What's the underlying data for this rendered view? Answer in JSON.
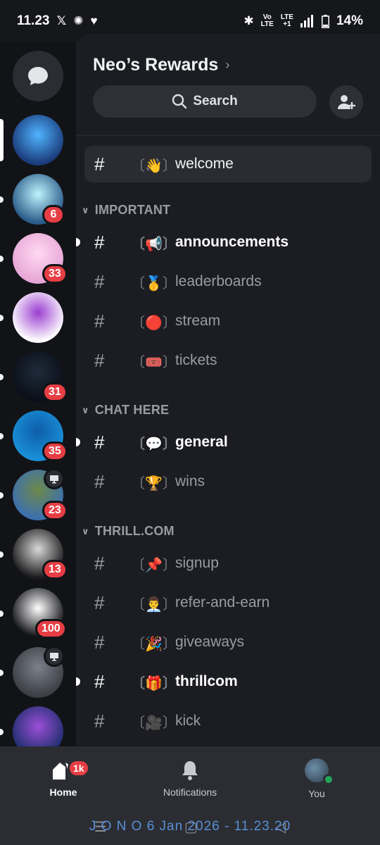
{
  "status_bar": {
    "time": "11.23",
    "left_icons": [
      "x-icon",
      "aperture-icon",
      "heart-icon"
    ],
    "network_top": "Vo",
    "network_bottom": "LTE",
    "lte_top": "LTE",
    "lte_bottom": "+1",
    "battery": "14%"
  },
  "servers": [
    {
      "name": "server-1",
      "badge": "",
      "colors": [
        "#1a3b7a",
        "#4fb4ff"
      ]
    },
    {
      "name": "server-2",
      "badge": "6",
      "colors": [
        "#2a5a88",
        "#bff4ff"
      ]
    },
    {
      "name": "server-3",
      "badge": "33",
      "colors": [
        "#e7a6d6",
        "#ffd9f2"
      ]
    },
    {
      "name": "server-4",
      "badge": "",
      "colors": [
        "#ffffff",
        "#9b3fd1"
      ]
    },
    {
      "name": "server-5",
      "badge": "31",
      "colors": [
        "#0b0f18",
        "#1e2b3a"
      ]
    },
    {
      "name": "server-6",
      "badge": "35",
      "colors": [
        "#1a8fd8",
        "#0d5ea8"
      ]
    },
    {
      "name": "server-7",
      "badge": "23",
      "colors": [
        "#3b6fae",
        "#6e8a4a"
      ]
    },
    {
      "name": "server-8",
      "badge": "13",
      "colors": [
        "#1b1b1d",
        "#d9d9d9"
      ]
    },
    {
      "name": "server-9",
      "badge": "100",
      "colors": [
        "#121317",
        "#ffffff"
      ]
    },
    {
      "name": "server-10",
      "badge": "",
      "colors": [
        "#3c3f45",
        "#7b808a"
      ]
    },
    {
      "name": "server-11",
      "badge": "",
      "colors": [
        "#1f2e6e",
        "#9b4fd8"
      ]
    }
  ],
  "server": {
    "name": "Neo’s Rewards",
    "chevron": "›",
    "search_label": "Search"
  },
  "channels_top": [
    {
      "hash": "#",
      "emoji": "〔👋〕",
      "name": "welcome"
    }
  ],
  "categories": [
    {
      "label": "IMPORTANT",
      "channels": [
        {
          "hash": "#",
          "emoji": "〔📢〕",
          "name": "announcements",
          "unread": true
        },
        {
          "hash": "#",
          "emoji": "〔🥇〕",
          "name": "leaderboards",
          "unread": false
        },
        {
          "hash": "#",
          "emoji": "〔🔴〕",
          "name": "stream",
          "unread": false
        },
        {
          "hash": "#",
          "emoji": "〔🎟️〕",
          "name": "tickets",
          "unread": false
        }
      ]
    },
    {
      "label": "CHAT HERE",
      "channels": [
        {
          "hash": "#",
          "emoji": "〔💬〕",
          "name": "general",
          "unread": true
        },
        {
          "hash": "#",
          "emoji": "〔🏆〕",
          "name": "wins",
          "unread": false
        }
      ]
    },
    {
      "label": "THRILL.COM",
      "channels": [
        {
          "hash": "#",
          "emoji": "〔📌〕",
          "name": "signup",
          "unread": false
        },
        {
          "hash": "#",
          "emoji": "〔👨‍💼〕",
          "name": "refer-and-earn",
          "unread": false
        },
        {
          "hash": "#",
          "emoji": "〔🎉〕",
          "name": "giveaways",
          "unread": false
        },
        {
          "hash": "#",
          "emoji": "〔🎁〕",
          "name": "thrillcom",
          "unread": true
        },
        {
          "hash": "#",
          "emoji": "〔🎥〕",
          "name": "kick",
          "unread": false
        }
      ]
    }
  ],
  "bottom_nav": {
    "home_label": "Home",
    "home_badge": "1k",
    "notifications_label": "Notifications",
    "you_label": "You"
  },
  "watermark": "J O N O 6 Jan 2026 - 11.23.20",
  "colors": {
    "background": "#1c1d22",
    "rail": "#121317",
    "badge": "#e63e44",
    "online": "#23a55a"
  }
}
